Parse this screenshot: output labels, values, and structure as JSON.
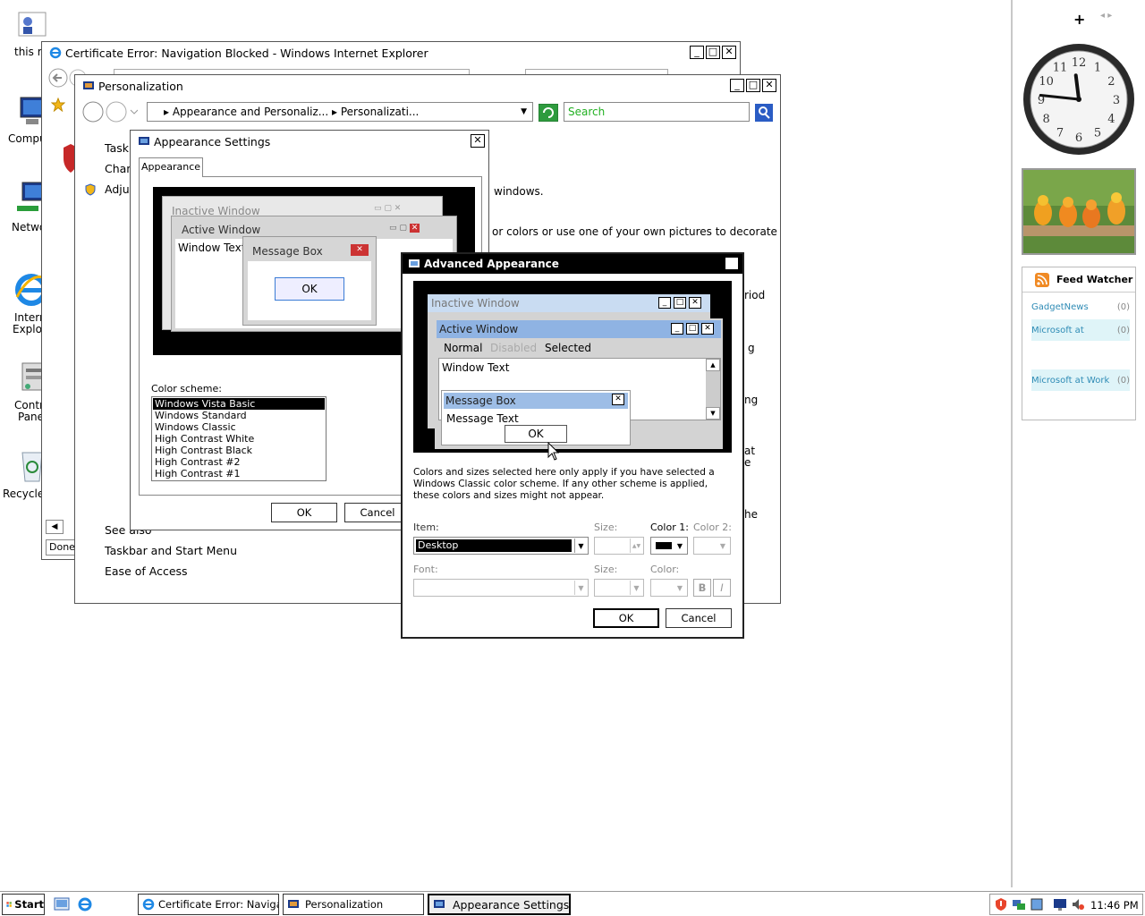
{
  "desktop": {
    "icons": [
      {
        "label": "this r",
        "icon": "user-folder-icon"
      },
      {
        "label": "Compu",
        "icon": "computer-icon"
      },
      {
        "label": "Netwo",
        "icon": "network-icon"
      },
      {
        "label1": "Intern",
        "label2": "Explo",
        "icon": "internet-explorer-icon"
      },
      {
        "label1": "Contr",
        "label2": "Pane",
        "icon": "control-panel-icon"
      },
      {
        "label": "Recycle",
        "icon": "recycle-bin-icon"
      }
    ]
  },
  "ie_window": {
    "title": "Certificate Error: Navigation Blocked - Windows Internet Explorer",
    "status": "Done"
  },
  "personalization": {
    "title": "Personalization",
    "breadcrumb": [
      "Appearance and Personaliz...",
      "Personalizati..."
    ],
    "search_placeholder": "Search",
    "tasks": [
      "Task",
      "Chan",
      "Adjus"
    ],
    "see_also_label": "See also",
    "see_also": [
      "Taskbar and Start Menu",
      "Ease of Access"
    ],
    "content_fragments": [
      "windows.",
      "or colors or use one of your own pictures to decorate",
      "riod",
      "g",
      "ng",
      "at",
      "e",
      "he"
    ]
  },
  "appearance_settings": {
    "title": "Appearance Settings",
    "tab": "Appearance",
    "preview": {
      "inactive": "Inactive Window",
      "active": "Active Window",
      "window_text": "Window Text",
      "message_box": "Message Box",
      "ok": "OK"
    },
    "color_scheme_label": "Color scheme:",
    "schemes": [
      "Windows Vista Basic",
      "Windows Standard",
      "Windows Classic",
      "High Contrast White",
      "High Contrast Black",
      "High Contrast #2",
      "High Contrast #1"
    ],
    "selected_scheme": "Windows Vista Basic",
    "ok": "OK",
    "cancel": "Cancel"
  },
  "advanced_appearance": {
    "title": "Advanced Appearance",
    "preview": {
      "inactive": "Inactive Window",
      "active": "Active Window",
      "menu_normal": "Normal",
      "menu_disabled": "Disabled",
      "menu_selected": "Selected",
      "window_text": "Window Text",
      "message_box": "Message Box",
      "message_text": "Message Text",
      "ok": "OK"
    },
    "note": "Colors and sizes selected here only apply if you have selected a Windows Classic color scheme. If any other scheme is applied, these colors and sizes might not appear.",
    "item_label": "Item:",
    "item_value": "Desktop",
    "size_label": "Size:",
    "color1_label": "Color 1:",
    "color2_label": "Color 2:",
    "font_label": "Font:",
    "font_size_label": "Size:",
    "font_color_label": "Color:",
    "bold": "B",
    "italic": "I",
    "color1_value": "#000000",
    "ok": "OK",
    "cancel": "Cancel"
  },
  "sidebar": {
    "add_symbol": "+",
    "clock": {
      "hour": 11,
      "minute": 46
    },
    "feed_title": "Feed Watcher",
    "feeds": [
      {
        "name": "GadgetNews",
        "count": "(0)"
      },
      {
        "name": "Microsoft at",
        "count": "(0)"
      },
      {
        "name": "Microsoft at Work",
        "count": "(0)"
      }
    ]
  },
  "taskbar": {
    "start": "Start",
    "buttons": [
      "Certificate Error: Navigati...",
      "Personalization",
      "Appearance Settings"
    ],
    "time": "11:46 PM"
  }
}
